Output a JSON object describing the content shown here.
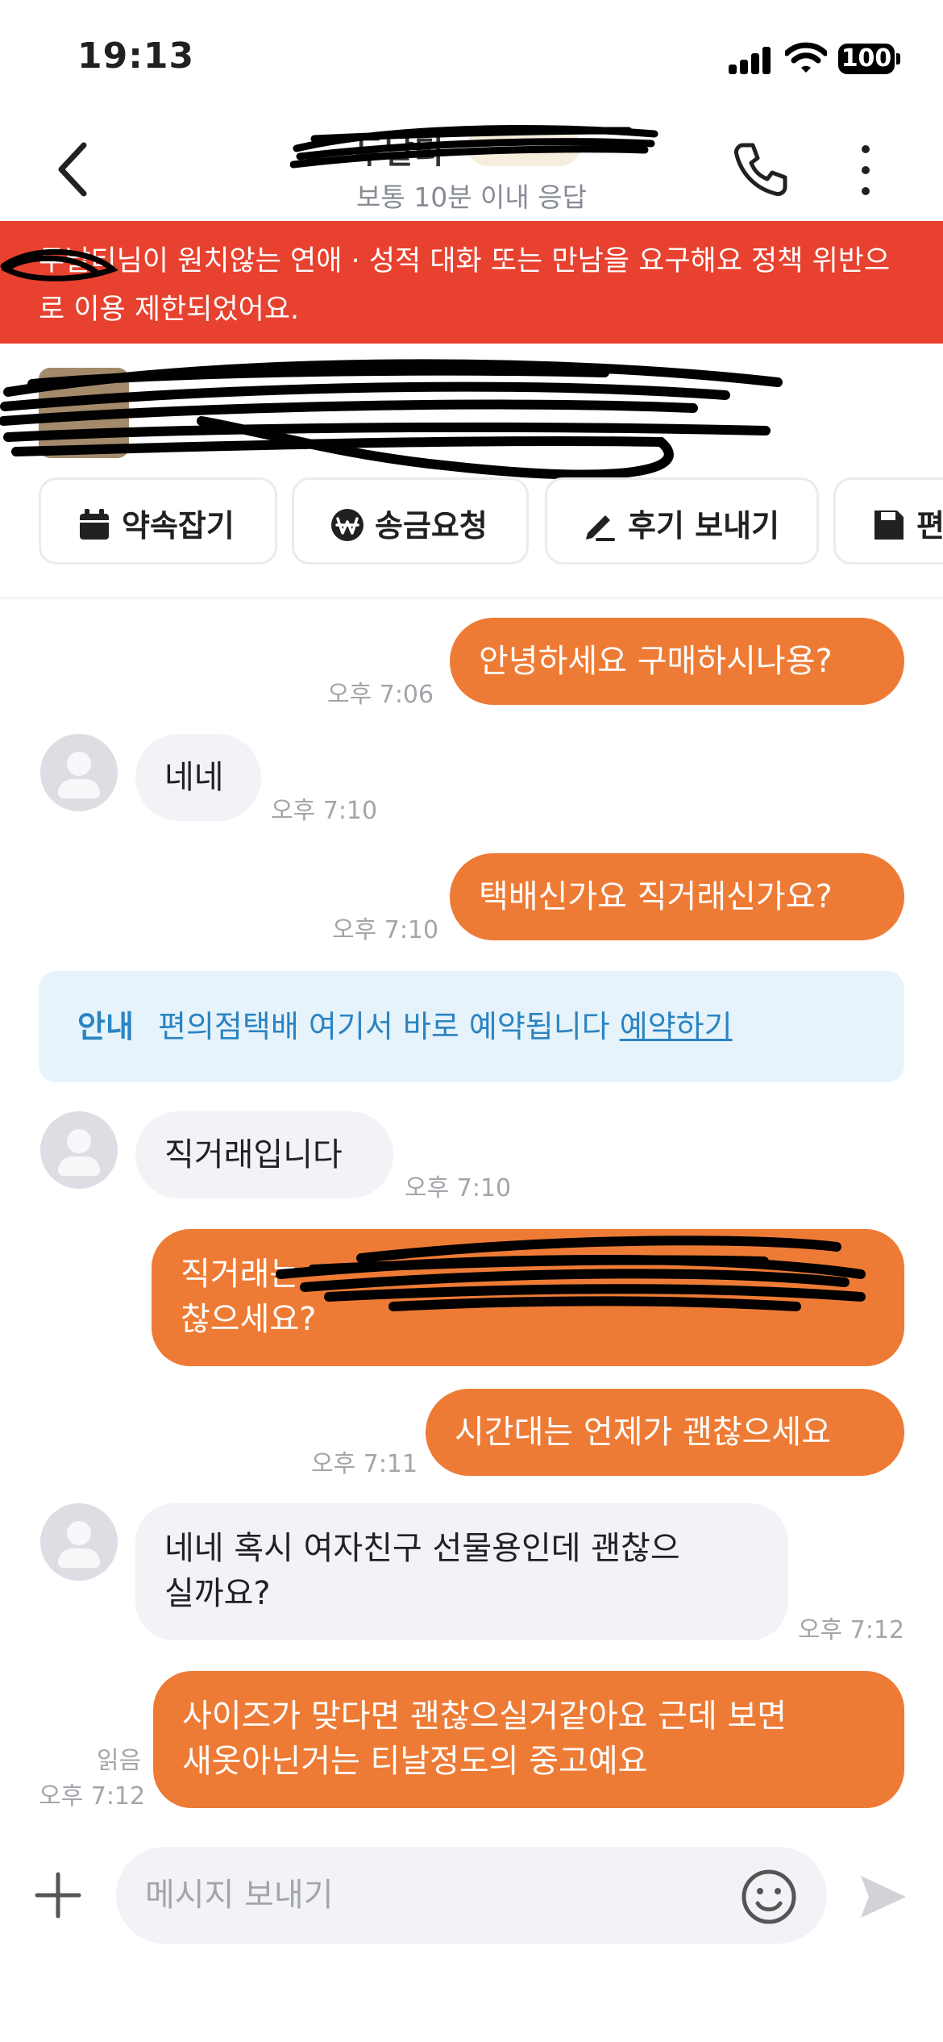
{
  "status_bar": {
    "time": "19:13",
    "battery": "100"
  },
  "header": {
    "name": "두날티",
    "subtitle": "보통 10분 이내 응답"
  },
  "warning": {
    "text": "두날티님이 원치않는 연애 · 성적 대화 또는 만남을 요구해요 정책 위반으로 이용 제한되었어요."
  },
  "chips": [
    {
      "label": "약속잡기",
      "icon": "calendar-icon"
    },
    {
      "label": "송금요청",
      "icon": "won-icon"
    },
    {
      "label": "후기 보내기",
      "icon": "pencil-icon"
    },
    {
      "label": "편",
      "icon": "save-icon"
    }
  ],
  "messages": {
    "m1": {
      "text": "안녕하세요 구매하시나용?",
      "time": "오후 7:06"
    },
    "m2": {
      "text": "네네",
      "time": "오후 7:10"
    },
    "m3": {
      "text": "택배신가요 직거래신가요?",
      "time": "오후 7:10"
    },
    "m4": {
      "text": "직거래입니다",
      "time": "오후 7:10"
    },
    "m5": {
      "line1": "직거래는",
      "line2": "찮으세요?"
    },
    "m6": {
      "text": "시간대는 언제가 괜찮으세요",
      "time": "오후 7:11"
    },
    "m7": {
      "line1": "네네 혹시 여자친구 선물용인데 괜찮으",
      "line2": "실까요?",
      "time": "오후 7:12"
    },
    "m8": {
      "line1": "사이즈가 맞다면 괜찮으실거같아요 근데 보면",
      "line2": "새옷아닌거는 티날정도의 중고예요",
      "time": "오후 7:12",
      "read": "읽음"
    }
  },
  "notice": {
    "title": "안내",
    "text": "편의점택배 여기서 바로 예약됩니다",
    "link": "예약하기"
  },
  "input": {
    "placeholder": "메시지 보내기"
  },
  "colors": {
    "accent": "#ee7b35",
    "warning": "#e8412f",
    "notice_bg": "#e6f3fb",
    "notice_text": "#2b84c2"
  }
}
